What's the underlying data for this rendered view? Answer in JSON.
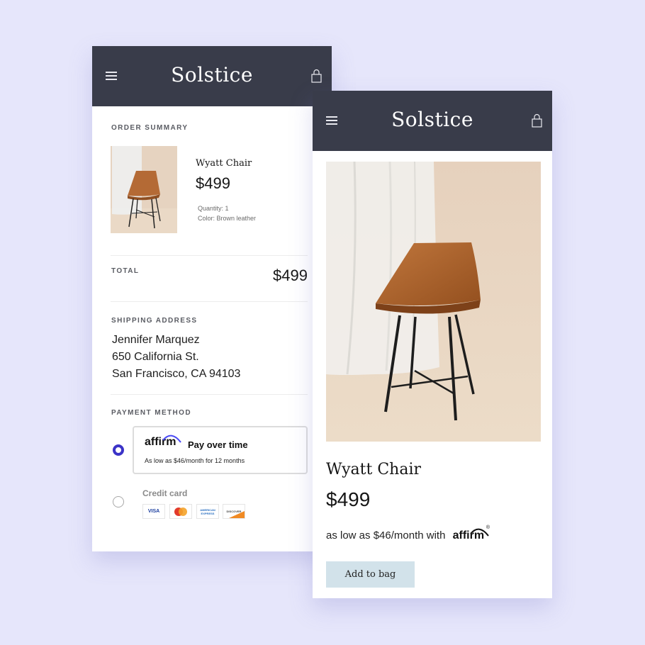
{
  "checkout_screen": {
    "brand": "Solstice",
    "order_summary_label": "ORDER SUMMARY",
    "item": {
      "name": "Wyatt Chair",
      "price": "$499",
      "quantity": "Quantity: 1",
      "color": "Color: Brown leather"
    },
    "total_label": "TOTAL",
    "total_value": "$499",
    "shipping_label": "SHIPPING ADDRESS",
    "shipping_address": [
      "Jennifer Marquez",
      "650 California St.",
      "San Francisco, CA 94103"
    ],
    "payment_label": "PAYMENT METHOD",
    "payment_options": [
      {
        "id": "affirm",
        "selected": true,
        "logo": "affirm",
        "title": "Pay over time",
        "subtitle": "As low as $46/month for 12 months"
      },
      {
        "id": "credit-card",
        "selected": false,
        "title": "Credit card",
        "cards": [
          "VISA",
          "MasterCard",
          "AMERICAN EXPRESS",
          "DISCOVER"
        ]
      }
    ]
  },
  "product_screen": {
    "brand": "Solstice",
    "product_name": "Wyatt Chair",
    "price": "$499",
    "financing_text": "as low as $46/month with",
    "financing_logo": "affirm",
    "add_to_bag_label": "Add to bag"
  },
  "icons": {
    "menu": "hamburger-menu-icon",
    "bag": "shopping-bag-icon"
  },
  "colors": {
    "background": "#e6e6fb",
    "header": "#393c4a",
    "accent": "#3b33c7",
    "affirm_arc": "#4a4af4",
    "add_button": "#d2e2ea"
  }
}
